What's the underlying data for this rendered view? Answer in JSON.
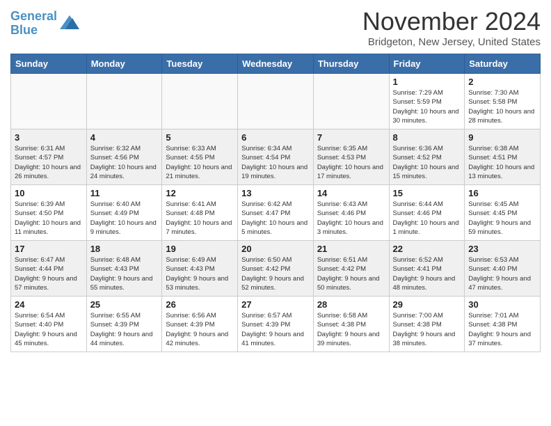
{
  "logo": {
    "line1": "General",
    "line2": "Blue",
    "icon_color": "#4a90c4"
  },
  "title": "November 2024",
  "location": "Bridgeton, New Jersey, United States",
  "day_headers": [
    "Sunday",
    "Monday",
    "Tuesday",
    "Wednesday",
    "Thursday",
    "Friday",
    "Saturday"
  ],
  "weeks": [
    [
      {
        "day": "",
        "info": "",
        "empty": true
      },
      {
        "day": "",
        "info": "",
        "empty": true
      },
      {
        "day": "",
        "info": "",
        "empty": true
      },
      {
        "day": "",
        "info": "",
        "empty": true
      },
      {
        "day": "",
        "info": "",
        "empty": true
      },
      {
        "day": "1",
        "info": "Sunrise: 7:29 AM\nSunset: 5:59 PM\nDaylight: 10 hours\nand 30 minutes."
      },
      {
        "day": "2",
        "info": "Sunrise: 7:30 AM\nSunset: 5:58 PM\nDaylight: 10 hours\nand 28 minutes."
      }
    ],
    [
      {
        "day": "3",
        "info": "Sunrise: 6:31 AM\nSunset: 4:57 PM\nDaylight: 10 hours\nand 26 minutes.",
        "shaded": true
      },
      {
        "day": "4",
        "info": "Sunrise: 6:32 AM\nSunset: 4:56 PM\nDaylight: 10 hours\nand 24 minutes.",
        "shaded": true
      },
      {
        "day": "5",
        "info": "Sunrise: 6:33 AM\nSunset: 4:55 PM\nDaylight: 10 hours\nand 21 minutes.",
        "shaded": true
      },
      {
        "day": "6",
        "info": "Sunrise: 6:34 AM\nSunset: 4:54 PM\nDaylight: 10 hours\nand 19 minutes.",
        "shaded": true
      },
      {
        "day": "7",
        "info": "Sunrise: 6:35 AM\nSunset: 4:53 PM\nDaylight: 10 hours\nand 17 minutes.",
        "shaded": true
      },
      {
        "day": "8",
        "info": "Sunrise: 6:36 AM\nSunset: 4:52 PM\nDaylight: 10 hours\nand 15 minutes.",
        "shaded": true
      },
      {
        "day": "9",
        "info": "Sunrise: 6:38 AM\nSunset: 4:51 PM\nDaylight: 10 hours\nand 13 minutes.",
        "shaded": true
      }
    ],
    [
      {
        "day": "10",
        "info": "Sunrise: 6:39 AM\nSunset: 4:50 PM\nDaylight: 10 hours\nand 11 minutes."
      },
      {
        "day": "11",
        "info": "Sunrise: 6:40 AM\nSunset: 4:49 PM\nDaylight: 10 hours\nand 9 minutes."
      },
      {
        "day": "12",
        "info": "Sunrise: 6:41 AM\nSunset: 4:48 PM\nDaylight: 10 hours\nand 7 minutes."
      },
      {
        "day": "13",
        "info": "Sunrise: 6:42 AM\nSunset: 4:47 PM\nDaylight: 10 hours\nand 5 minutes."
      },
      {
        "day": "14",
        "info": "Sunrise: 6:43 AM\nSunset: 4:46 PM\nDaylight: 10 hours\nand 3 minutes."
      },
      {
        "day": "15",
        "info": "Sunrise: 6:44 AM\nSunset: 4:46 PM\nDaylight: 10 hours\nand 1 minute."
      },
      {
        "day": "16",
        "info": "Sunrise: 6:45 AM\nSunset: 4:45 PM\nDaylight: 9 hours\nand 59 minutes."
      }
    ],
    [
      {
        "day": "17",
        "info": "Sunrise: 6:47 AM\nSunset: 4:44 PM\nDaylight: 9 hours\nand 57 minutes.",
        "shaded": true
      },
      {
        "day": "18",
        "info": "Sunrise: 6:48 AM\nSunset: 4:43 PM\nDaylight: 9 hours\nand 55 minutes.",
        "shaded": true
      },
      {
        "day": "19",
        "info": "Sunrise: 6:49 AM\nSunset: 4:43 PM\nDaylight: 9 hours\nand 53 minutes.",
        "shaded": true
      },
      {
        "day": "20",
        "info": "Sunrise: 6:50 AM\nSunset: 4:42 PM\nDaylight: 9 hours\nand 52 minutes.",
        "shaded": true
      },
      {
        "day": "21",
        "info": "Sunrise: 6:51 AM\nSunset: 4:42 PM\nDaylight: 9 hours\nand 50 minutes.",
        "shaded": true
      },
      {
        "day": "22",
        "info": "Sunrise: 6:52 AM\nSunset: 4:41 PM\nDaylight: 9 hours\nand 48 minutes.",
        "shaded": true
      },
      {
        "day": "23",
        "info": "Sunrise: 6:53 AM\nSunset: 4:40 PM\nDaylight: 9 hours\nand 47 minutes.",
        "shaded": true
      }
    ],
    [
      {
        "day": "24",
        "info": "Sunrise: 6:54 AM\nSunset: 4:40 PM\nDaylight: 9 hours\nand 45 minutes."
      },
      {
        "day": "25",
        "info": "Sunrise: 6:55 AM\nSunset: 4:39 PM\nDaylight: 9 hours\nand 44 minutes."
      },
      {
        "day": "26",
        "info": "Sunrise: 6:56 AM\nSunset: 4:39 PM\nDaylight: 9 hours\nand 42 minutes."
      },
      {
        "day": "27",
        "info": "Sunrise: 6:57 AM\nSunset: 4:39 PM\nDaylight: 9 hours\nand 41 minutes."
      },
      {
        "day": "28",
        "info": "Sunrise: 6:58 AM\nSunset: 4:38 PM\nDaylight: 9 hours\nand 39 minutes."
      },
      {
        "day": "29",
        "info": "Sunrise: 7:00 AM\nSunset: 4:38 PM\nDaylight: 9 hours\nand 38 minutes."
      },
      {
        "day": "30",
        "info": "Sunrise: 7:01 AM\nSunset: 4:38 PM\nDaylight: 9 hours\nand 37 minutes."
      }
    ]
  ]
}
